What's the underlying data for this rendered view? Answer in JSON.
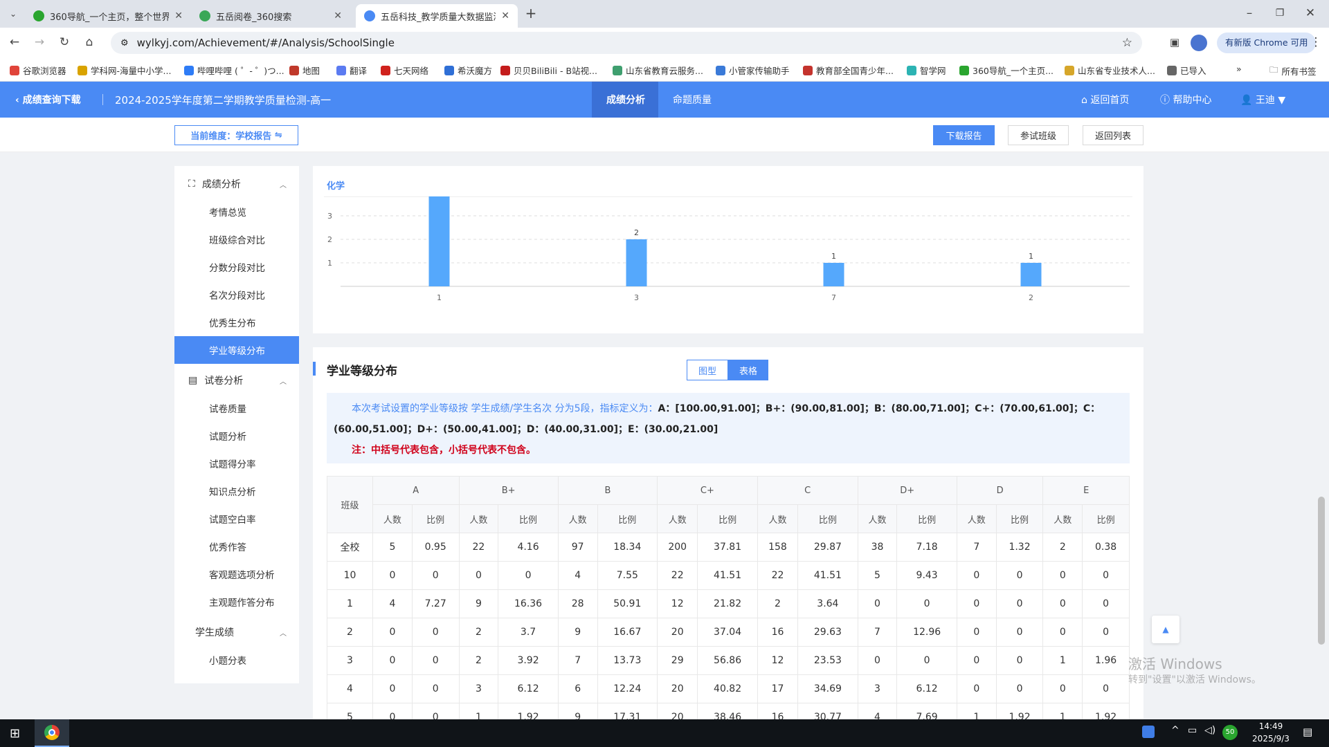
{
  "browser": {
    "tabs": [
      {
        "title": "360导航_一个主页，整个世界",
        "favicon_color": "#2aa52f"
      },
      {
        "title": "五岳阅卷_360搜索",
        "favicon_color": "#3aa757"
      },
      {
        "title": "五岳科技_教学质量大数据监测平台",
        "favicon_color": "#4a8af4",
        "active": true
      }
    ],
    "url": "wylkyj.com/Achievement/#/Analysis/SchoolSingle",
    "update_label": "有新版 Chrome 可用",
    "bookmarks": [
      {
        "label": "谷歌浏览器",
        "color": "#e0443a"
      },
      {
        "label": "学科网-海量中小学...",
        "color": "#d9a300"
      },
      {
        "label": "哔哩哔哩 ( ゜- ゜)つ...",
        "color": "#2e7cf6"
      },
      {
        "label": "地图",
        "color": "#c0392b"
      },
      {
        "label": "翻译",
        "color": "#5b7bf1"
      },
      {
        "label": "七天网络",
        "color": "#d0221d"
      },
      {
        "label": "希沃魔方",
        "color": "#2f6fd6"
      },
      {
        "label": "贝贝BiliBili - B站视...",
        "color": "#c41c1c"
      },
      {
        "label": "山东省教育云服务...",
        "color": "#3f9f6f"
      },
      {
        "label": "小管家传输助手",
        "color": "#3a7ad8"
      },
      {
        "label": "教育部全国青少年...",
        "color": "#c4332d"
      },
      {
        "label": "智学网",
        "color": "#2cb3b3"
      },
      {
        "label": "360导航_一个主页...",
        "color": "#2aa52f"
      },
      {
        "label": "山东省专业技术人...",
        "color": "#d6a62a"
      },
      {
        "label": "已导入",
        "color": "#666666"
      }
    ],
    "all_bookmarks": "所有书签"
  },
  "app": {
    "back_label": "成绩查询下载",
    "exam_title": "2024-2025学年度第二学期教学质量检测-高一",
    "nav": [
      "成绩分析",
      "命题质量"
    ],
    "home": "返回首页",
    "help": "帮助中心",
    "user": "王迪",
    "dimension": "当前维度：学校报告",
    "buttons": {
      "download": "下载报告",
      "classes": "参试班级",
      "back_list": "返回列表"
    }
  },
  "sidebar": {
    "groups": [
      {
        "label": "成绩分析",
        "items": [
          "考情总览",
          "班级综合对比",
          "分数分段对比",
          "名次分段对比",
          "优秀生分布",
          "学业等级分布"
        ]
      },
      {
        "label": "试卷分析",
        "items": [
          "试卷质量",
          "试题分析",
          "试题得分率",
          "知识点分析",
          "试题空白率",
          "优秀作答",
          "客观题选项分析",
          "主观题作答分布"
        ]
      },
      {
        "label": "学生成绩",
        "items": [
          "小题分表"
        ]
      }
    ],
    "active": "学业等级分布"
  },
  "chart_panel": {
    "subject_tab": "化学"
  },
  "chart_data": {
    "type": "bar",
    "categories": [
      "1",
      "3",
      "7",
      "2"
    ],
    "values": [
      4,
      2,
      1,
      1
    ],
    "data_labels": [
      "",
      "2",
      "1",
      "1"
    ],
    "yticks": [
      1,
      2,
      3,
      4
    ],
    "ylim": [
      0,
      4
    ],
    "color": "#55a8fc"
  },
  "grade_section": {
    "title": "学业等级分布",
    "toggle": [
      "图型",
      "表格"
    ],
    "toggle_active": "表格",
    "note_prefix": "本次考试设置的学业等级按 学生成绩/学生名次 分为5段，指标定义为：",
    "note_def": "A：[100.00,91.00]；B+：(90.00,81.00]；B：(80.00,71.00]；C+：(70.00,61.00]；C：(60.00,51.00]；D+：(50.00,41.00]；D：(40.00,31.00]；E：(30.00,21.00]",
    "note_warn": "注：中括号代表包含，小括号代表不包含。",
    "table": {
      "class_header": "班级",
      "levels": [
        "A",
        "B+",
        "B",
        "C+",
        "C",
        "D+",
        "D",
        "E"
      ],
      "sub": [
        "人数",
        "比例"
      ],
      "rows": [
        [
          "全校",
          "5",
          "0.95",
          "22",
          "4.16",
          "97",
          "18.34",
          "200",
          "37.81",
          "158",
          "29.87",
          "38",
          "7.18",
          "7",
          "1.32",
          "2",
          "0.38"
        ],
        [
          "10",
          "0",
          "0",
          "0",
          "0",
          "4",
          "7.55",
          "22",
          "41.51",
          "22",
          "41.51",
          "5",
          "9.43",
          "0",
          "0",
          "0",
          "0"
        ],
        [
          "1",
          "4",
          "7.27",
          "9",
          "16.36",
          "28",
          "50.91",
          "12",
          "21.82",
          "2",
          "3.64",
          "0",
          "0",
          "0",
          "0",
          "0",
          "0"
        ],
        [
          "2",
          "0",
          "0",
          "2",
          "3.7",
          "9",
          "16.67",
          "20",
          "37.04",
          "16",
          "29.63",
          "7",
          "12.96",
          "0",
          "0",
          "0",
          "0"
        ],
        [
          "3",
          "0",
          "0",
          "2",
          "3.92",
          "7",
          "13.73",
          "29",
          "56.86",
          "12",
          "23.53",
          "0",
          "0",
          "0",
          "0",
          "1",
          "1.96"
        ],
        [
          "4",
          "0",
          "0",
          "3",
          "6.12",
          "6",
          "12.24",
          "20",
          "40.82",
          "17",
          "34.69",
          "3",
          "6.12",
          "0",
          "0",
          "0",
          "0"
        ],
        [
          "5",
          "0",
          "0",
          "1",
          "1.92",
          "9",
          "17.31",
          "20",
          "38.46",
          "16",
          "30.77",
          "4",
          "7.69",
          "1",
          "1.92",
          "1",
          "1.92"
        ]
      ]
    }
  },
  "watermark": {
    "line1": "激活 Windows",
    "line2": "转到\"设置\"以激活 Windows。"
  },
  "taskbar": {
    "time": "14:49",
    "date": "2025/9/3",
    "badge": "50"
  }
}
